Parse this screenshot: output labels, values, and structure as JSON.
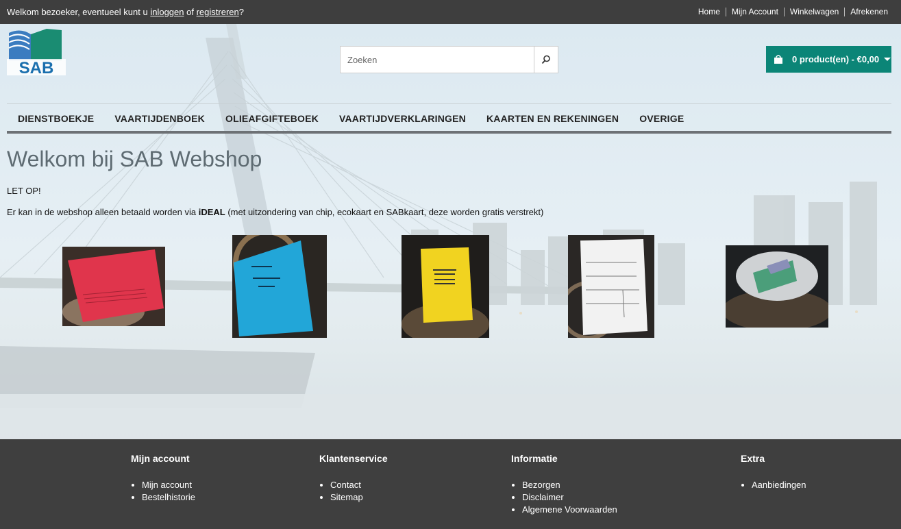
{
  "topbar": {
    "welcome_prefix": "Welkom bezoeker, eventueel kunt u",
    "login_link": "inloggen",
    "welcome_mid": "of",
    "register_link": "registreren",
    "welcome_suffix": "?",
    "links": [
      "Home",
      "Mijn Account",
      "Winkelwagen",
      "Afrekenen"
    ]
  },
  "header": {
    "logo_text": "SAB",
    "search_placeholder": "Zoeken",
    "cart_label": "0 product(en) - €0,00"
  },
  "nav": {
    "items": [
      "DIENSTBOEKJE",
      "VAARTIJDENBOEK",
      "OLIEAFGIFTEBOEK",
      "VAARTIJDVERKLARINGEN",
      "KAARTEN EN REKENINGEN",
      "OVERIGE"
    ]
  },
  "main": {
    "title": "Welkom bij SAB Webshop",
    "notice": "LET OP!",
    "info_prefix": "Er kan in de webshop alleen betaald worden via",
    "info_bold": "iDEAL",
    "info_suffix": "(met uitzondering van chip, ecokaart en SABkaart, deze worden gratis verstrekt)"
  },
  "products": [
    {
      "name": "red-booklet",
      "color": "#e0354c"
    },
    {
      "name": "blue-booklet",
      "color": "#22a6d8"
    },
    {
      "name": "yellow-booklet",
      "color": "#f1d320"
    },
    {
      "name": "white-form",
      "color": "#f2f2f2"
    },
    {
      "name": "card-on-bollard",
      "color": "#4b9e7a"
    }
  ],
  "footer": {
    "columns": [
      {
        "title": "Mijn account",
        "items": [
          "Mijn account",
          "Bestelhistorie"
        ]
      },
      {
        "title": "Klantenservice",
        "items": [
          "Contact",
          "Sitemap"
        ]
      },
      {
        "title": "Informatie",
        "items": [
          "Bezorgen",
          "Disclaimer",
          "Algemene Voorwaarden"
        ]
      },
      {
        "title": "Extra",
        "items": [
          "Aanbiedingen"
        ]
      }
    ]
  },
  "colors": {
    "topbar": "#3e3e3e",
    "cart": "#0b8577",
    "footer": "#3f3f3f",
    "title": "#5e6b72"
  }
}
